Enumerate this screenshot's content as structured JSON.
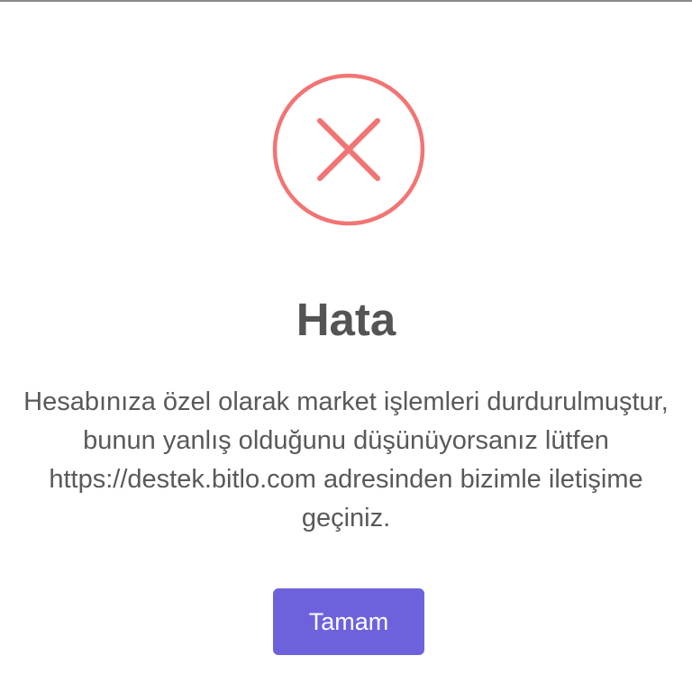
{
  "dialog": {
    "icon": "error-x-icon",
    "icon_color": "#f27474",
    "title": "Hata",
    "message_lines": [
      "Hesabınıza özel olarak market işlemleri durdurulmuştur,",
      "bunun yanlış olduğunu düşünüyorsanız lütfen",
      "https://destek.bitlo.com adresinden bizimle iletişime",
      "geçiniz."
    ],
    "confirm_label": "Tamam",
    "confirm_color": "#6e62dc"
  }
}
